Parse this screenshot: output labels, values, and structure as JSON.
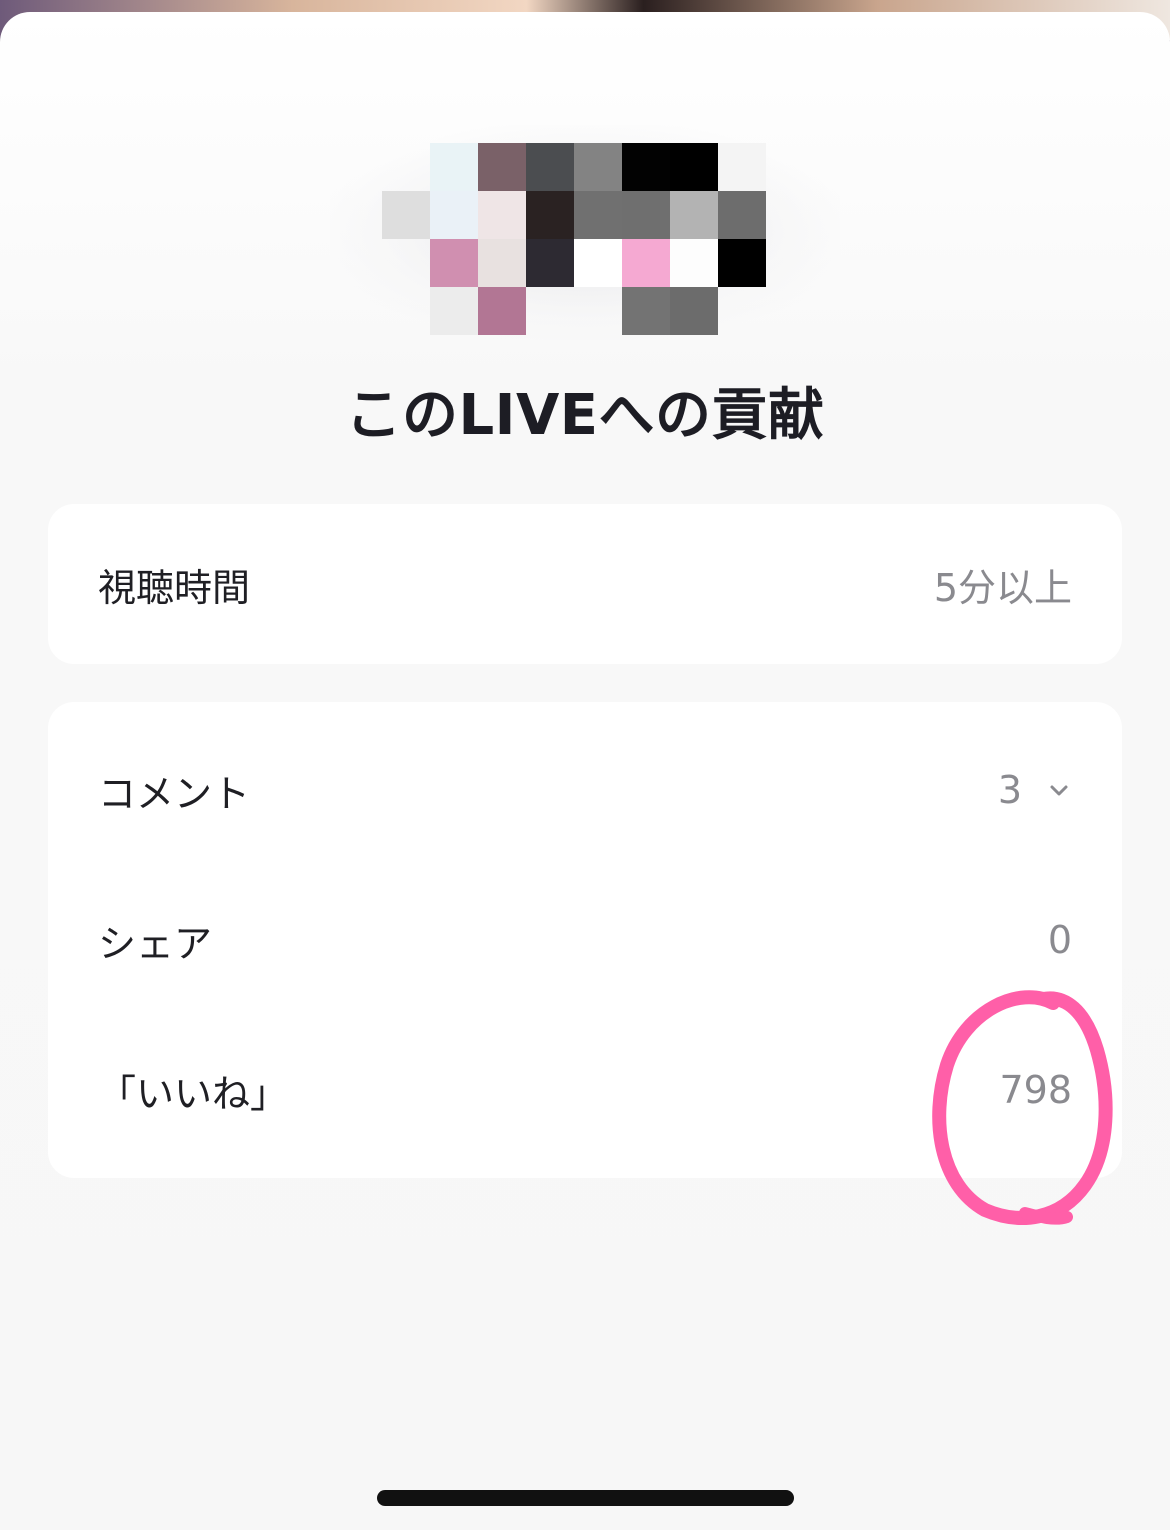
{
  "title": "このLIVEへの貢献",
  "watch_card": {
    "label": "視聴時間",
    "value": "5分以上"
  },
  "stats": {
    "comment": {
      "label": "コメント",
      "value": "3"
    },
    "share": {
      "label": "シェア",
      "value": "0"
    },
    "likes": {
      "label": "「いいね」",
      "value": "798"
    }
  },
  "icons": {
    "expand": "chevron-down-icon"
  },
  "colors": {
    "annotation": "#ff5fa8",
    "title": "#1d1d24",
    "value_gray": "#8a8a8f"
  }
}
